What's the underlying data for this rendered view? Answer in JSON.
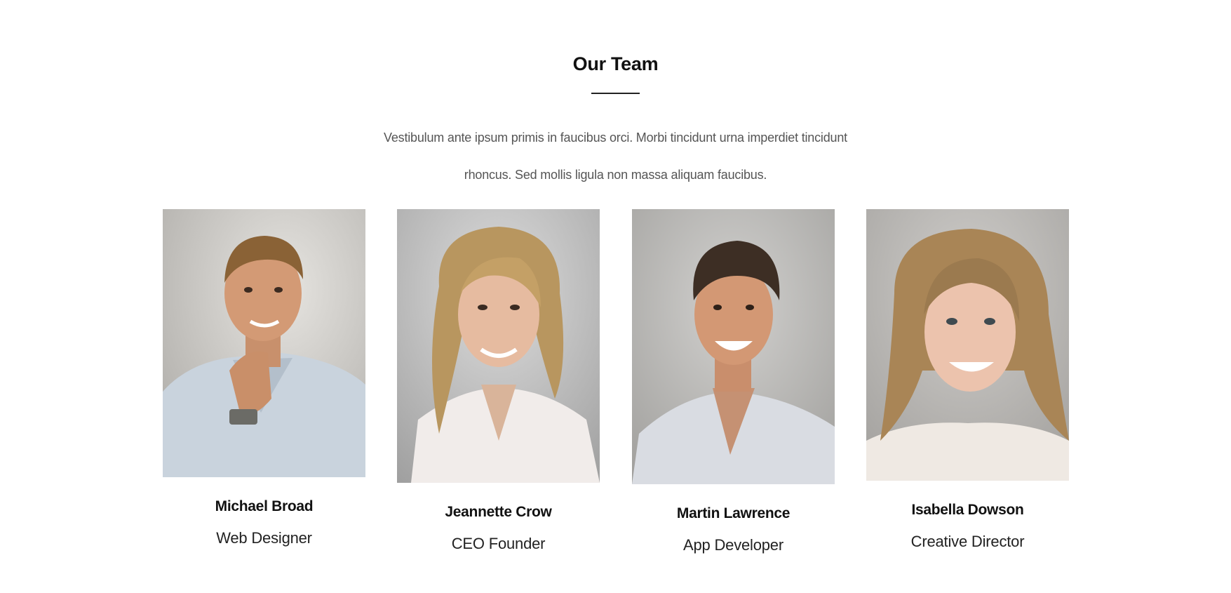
{
  "section": {
    "title": "Our Team",
    "intro": "Vestibulum ante ipsum primis in faucibus orci. Morbi tincidunt urna imperdiet tincidunt rhoncus. Sed mollis ligula non massa aliquam faucibus."
  },
  "team": [
    {
      "name": "Michael Broad",
      "role": "Web Designer",
      "photo_icon": "portrait-man-photo"
    },
    {
      "name": "Jeannette Crow",
      "role": "CEO Founder",
      "photo_icon": "portrait-woman-photo"
    },
    {
      "name": "Martin Lawrence",
      "role": "App Developer",
      "photo_icon": "portrait-man-photo"
    },
    {
      "name": "Isabella Dowson",
      "role": "Creative Director",
      "photo_icon": "portrait-woman-photo"
    }
  ]
}
